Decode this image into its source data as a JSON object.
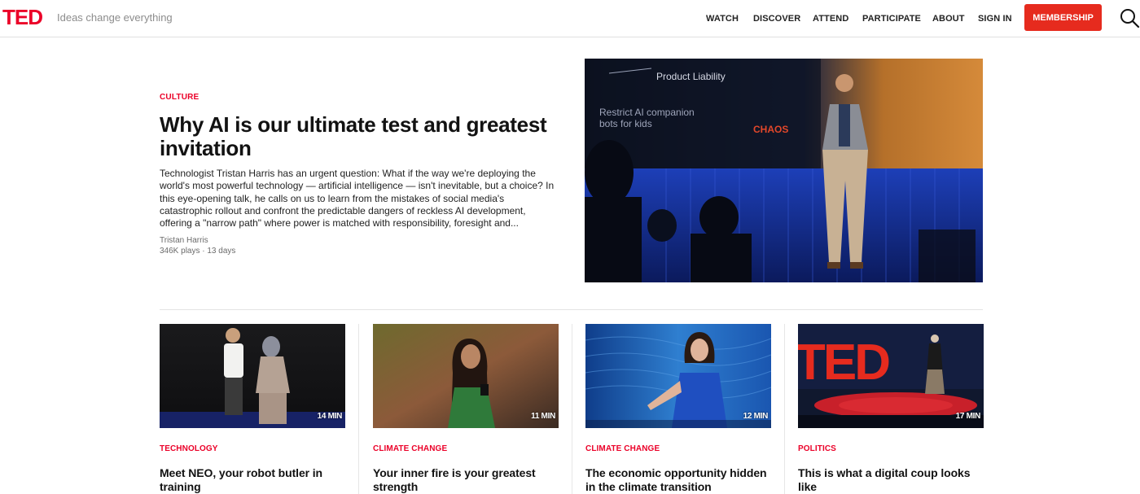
{
  "header": {
    "logo": "TED",
    "tagline": "Ideas change everything",
    "nav": [
      "WATCH",
      "DISCOVER",
      "ATTEND",
      "PARTICIPATE",
      "ABOUT",
      "SIGN IN"
    ],
    "membership": "MEMBERSHIP",
    "search_icon": "search-icon"
  },
  "hero": {
    "category": "CULTURE",
    "title": "Why AI is our ultimate test and greatest invitation",
    "description": "Technologist Tristan Harris has an urgent question: What if the way we're deploying the world's most powerful technology — artificial intelligence — isn't inevitable, but a choice? In this eye-opening talk, he calls on us to learn from the mistakes of social media's catastrophic rollout and confront the predictable dangers of reckless AI development, offering a \"narrow path\" where power is matched with responsibility, foresight and...",
    "speaker": "Tristan Harris",
    "meta": "346K plays · 13 days",
    "slide_text_1": "Product Liability",
    "slide_text_2": "Restrict AI companion",
    "slide_text_3": "bots for kids",
    "slide_text_4": "CHAOS"
  },
  "cards": [
    {
      "duration": "14 MIN",
      "category": "TECHNOLOGY",
      "title": "Meet NEO, your robot butler in training"
    },
    {
      "duration": "11 MIN",
      "category": "CLIMATE CHANGE",
      "title": "Your inner fire is your greatest strength"
    },
    {
      "duration": "12 MIN",
      "category": "CLIMATE CHANGE",
      "title": "The economic opportunity hidden in the climate transition"
    },
    {
      "duration": "17 MIN",
      "category": "POLITICS",
      "title": "This is what a digital coup looks like",
      "stage_text": "TED"
    }
  ],
  "colors": {
    "brand_red": "#eb0028",
    "membership_red": "#e62b1e"
  }
}
